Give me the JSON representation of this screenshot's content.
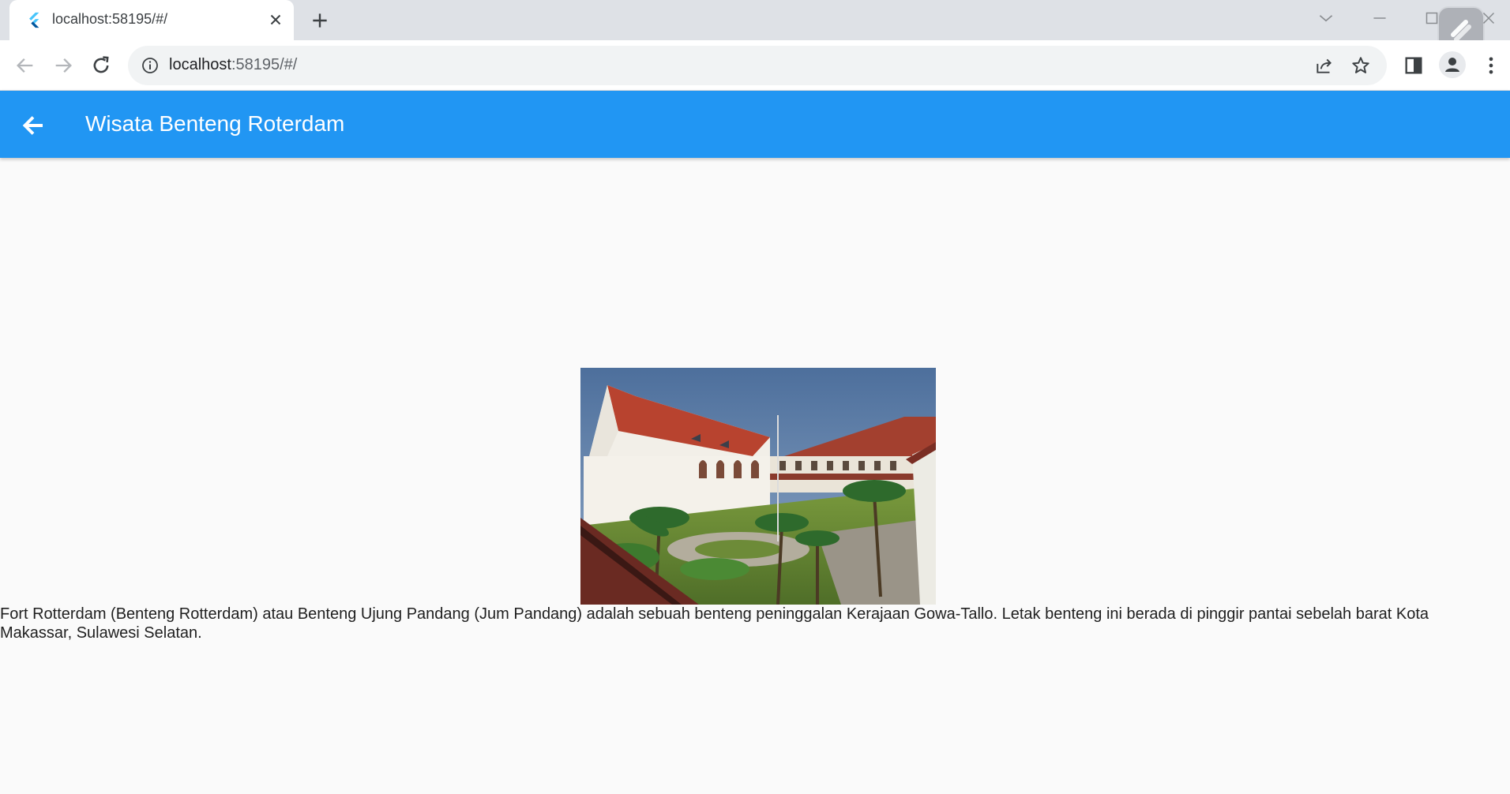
{
  "browser": {
    "tab_title": "localhost:58195/#/",
    "url_host": "localhost",
    "url_rest": ":58195/#/"
  },
  "appbar": {
    "title": "Wisata Benteng Roterdam",
    "color": "#2196f3"
  },
  "content": {
    "image_subject": "Fort Rotterdam courtyard with white colonial buildings, red tiled roofs and palm trees",
    "description": "Fort Rotterdam (Benteng Rotterdam) atau Benteng Ujung Pandang (Jum Pandang) adalah sebuah benteng peninggalan Kerajaan Gowa-Tallo. Letak benteng ini berada di pinggir pantai sebelah barat Kota Makassar, Sulawesi Selatan."
  },
  "icons": {
    "tab_favicon": "flutter-icon",
    "tab_close": "close-icon",
    "new_tab": "plus-icon",
    "back": "arrow-left-icon",
    "forward": "arrow-right-icon",
    "reload": "reload-icon",
    "site_info": "info-icon",
    "share": "share-icon",
    "bookmark": "star-icon",
    "side_panel": "side-panel-icon",
    "profile": "profile-icon",
    "menu": "kebab-menu-icon",
    "app_back": "arrow-left-icon"
  }
}
